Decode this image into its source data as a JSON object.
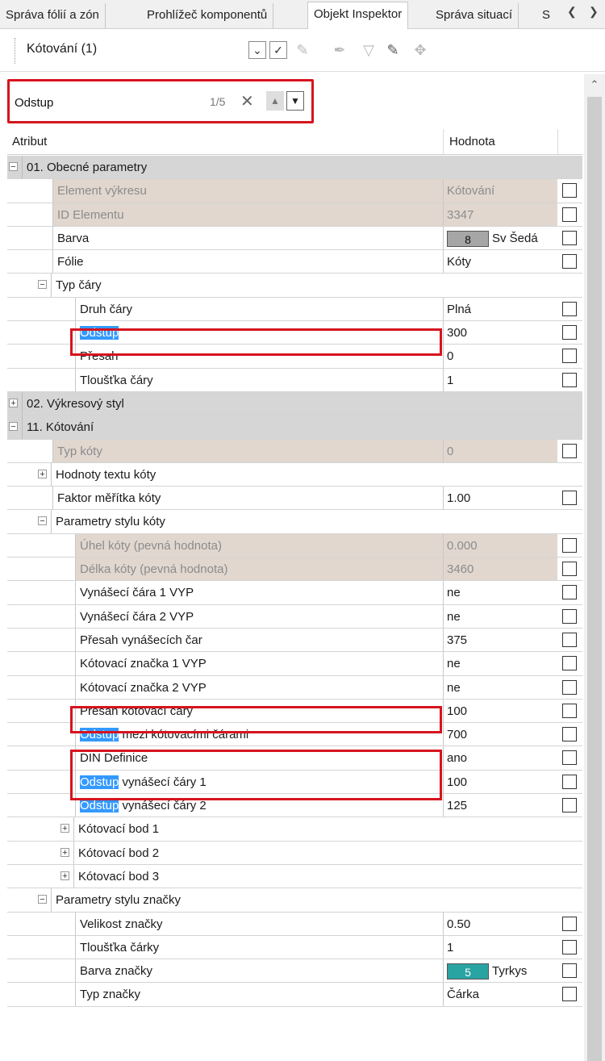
{
  "tabs": [
    {
      "label": "Správa fólií a zón",
      "active": false
    },
    {
      "label": "Prohlížeč komponentů",
      "active": false
    },
    {
      "label": "Objekt Inspektor",
      "active": true
    },
    {
      "label": "Správa situací",
      "active": false
    },
    {
      "label": "S",
      "active": false
    }
  ],
  "toolbar": {
    "selection_label": "Kótování (1)",
    "icons": [
      "chevron-down-icon",
      "check-icon",
      "edit-disabled-icon",
      "brush-disabled-icon",
      "filter-disabled-icon",
      "eyedropper-icon",
      "wand-disabled-icon"
    ]
  },
  "search": {
    "value": "Odstup",
    "counter": "1/5"
  },
  "grid": {
    "header_attribute": "Atribut",
    "header_value": "Hodnota",
    "rows": [
      {
        "type": "group",
        "level": 0,
        "toggle": "−",
        "label": "01. Obecné parametry"
      },
      {
        "type": "prop",
        "level": 0,
        "label": "Element výkresu",
        "value": "Kótování",
        "readonly": true
      },
      {
        "type": "prop",
        "level": 0,
        "label": "ID Elementu",
        "value": "3347",
        "readonly": true
      },
      {
        "type": "prop",
        "level": 0,
        "label": "Barva",
        "value": "Sv Šedá",
        "swatch": {
          "number": "8",
          "color": "#a6a6a6"
        }
      },
      {
        "type": "prop",
        "level": 0,
        "label": "Fólie",
        "value": "Kóty"
      },
      {
        "type": "subgroup",
        "level": 1,
        "toggle": "−",
        "label": "Typ čáry"
      },
      {
        "type": "prop",
        "level": 1,
        "label": "Druh čáry",
        "value": "Plná"
      },
      {
        "type": "prop",
        "level": 1,
        "label": "",
        "highlight": "Odstup",
        "value": "300"
      },
      {
        "type": "prop",
        "level": 1,
        "label": "Přesah",
        "value": "0"
      },
      {
        "type": "prop",
        "level": 1,
        "label": "Tloušťka čáry",
        "value": "1"
      },
      {
        "type": "group",
        "level": 0,
        "toggle": "+",
        "label": "02. Výkresový styl"
      },
      {
        "type": "group",
        "level": 0,
        "toggle": "−",
        "label": "11. Kótování"
      },
      {
        "type": "prop",
        "level": 0,
        "label": "Typ kóty",
        "value": "0",
        "readonly": true
      },
      {
        "type": "subgroup",
        "level": 1,
        "toggle": "+",
        "label": "Hodnoty textu kóty"
      },
      {
        "type": "prop",
        "level": 0,
        "label": "Faktor měřítka kóty",
        "value": "1.00"
      },
      {
        "type": "subgroup",
        "level": 1,
        "toggle": "−",
        "label": "Parametry stylu kóty"
      },
      {
        "type": "prop",
        "level": 1,
        "label": "Úhel kóty (pevná hodnota)",
        "value": "0.000",
        "readonly": true
      },
      {
        "type": "prop",
        "level": 1,
        "label": "Délka kóty (pevná hodnota)",
        "value": "3460",
        "readonly": true
      },
      {
        "type": "prop",
        "level": 1,
        "label": "Vynášecí čára 1 VYP",
        "value": "ne"
      },
      {
        "type": "prop",
        "level": 1,
        "label": "Vynášecí čára 2 VYP",
        "value": "ne"
      },
      {
        "type": "prop",
        "level": 1,
        "label": "Přesah vynášecích čar",
        "value": "375"
      },
      {
        "type": "prop",
        "level": 1,
        "label": "Kótovací značka 1 VYP",
        "value": "ne"
      },
      {
        "type": "prop",
        "level": 1,
        "label": "Kótovací značka 2 VYP",
        "value": "ne"
      },
      {
        "type": "prop",
        "level": 1,
        "label": "Přesah kótovací čáry",
        "value": "100"
      },
      {
        "type": "prop",
        "level": 1,
        "label": " mezi kótovacími čárami",
        "highlight": "Odstup",
        "value": "700"
      },
      {
        "type": "prop",
        "level": 1,
        "label": "DIN Definice",
        "value": "ano"
      },
      {
        "type": "prop",
        "level": 1,
        "label": " vynášecí čáry 1",
        "highlight": "Odstup",
        "value": "100"
      },
      {
        "type": "prop",
        "level": 1,
        "label": " vynášecí čáry 2",
        "highlight": "Odstup",
        "value": "125"
      },
      {
        "type": "subgroup",
        "level": 2,
        "toggle": "+",
        "label": "Kótovací bod 1"
      },
      {
        "type": "subgroup",
        "level": 2,
        "toggle": "+",
        "label": "Kótovací bod 2"
      },
      {
        "type": "subgroup",
        "level": 2,
        "toggle": "+",
        "label": "Kótovací bod 3"
      },
      {
        "type": "subgroup",
        "level": 1,
        "toggle": "−",
        "label": "Parametry stylu značky"
      },
      {
        "type": "prop",
        "level": 1,
        "label": "Velikost značky",
        "value": "0.50"
      },
      {
        "type": "prop",
        "level": 1,
        "label": "Tloušťka čárky",
        "value": "1"
      },
      {
        "type": "prop",
        "level": 1,
        "label": "Barva značky",
        "value": "Tyrkys",
        "swatch": {
          "number": "5",
          "color": "#2aa3a3"
        }
      },
      {
        "type": "prop",
        "level": 1,
        "label": "Typ značky",
        "value": "Čárka"
      }
    ]
  },
  "colors": {
    "highlight_frame": "#d6141e",
    "search_highlight": "#3399ff",
    "readonly_bg": "#e1d7cf",
    "group_bg": "#d6d6d6"
  }
}
